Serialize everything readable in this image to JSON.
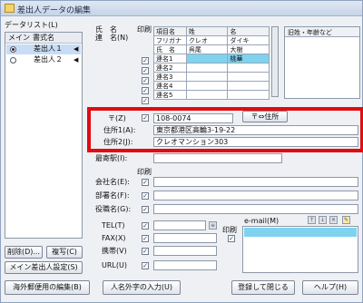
{
  "window": {
    "title": "差出人データの編集"
  },
  "data_list": {
    "label": "データリスト(L)",
    "columns": [
      "メイン",
      "書式名"
    ],
    "rows": [
      {
        "main_selected": true,
        "name": "差出人１"
      },
      {
        "main_selected": false,
        "name": "差出人２"
      }
    ]
  },
  "names": {
    "label_line1": "氏　名",
    "label_line2": "連　名(N)",
    "print_label": "印刷",
    "headers": [
      "項目名",
      "姓",
      "名"
    ],
    "rows": [
      {
        "item": "フリガナ",
        "sei": "クレオ",
        "mei": "ダイキ",
        "print": null
      },
      {
        "item": "氏　名",
        "sei": "呉尾",
        "mei": "大樹",
        "print": null
      },
      {
        "item": "連名1",
        "sei": "",
        "mei": "桃華",
        "print": true
      },
      {
        "item": "連名2",
        "sei": "",
        "mei": "",
        "print": true
      },
      {
        "item": "連名3",
        "sei": "",
        "mei": "",
        "print": true
      },
      {
        "item": "連名4",
        "sei": "",
        "mei": "",
        "print": true
      },
      {
        "item": "連名5",
        "sei": "",
        "mei": "",
        "print": true
      }
    ],
    "old_name_label": "旧姓・年齢など"
  },
  "address": {
    "zip_label": "〒(Z)",
    "zip_value": "108-0074",
    "zip_button": "〒⇔住所",
    "addr1_label": "住所1(A):",
    "addr1_value": "東京都港区高輪3-19-22",
    "addr2_label": "住所2(J):",
    "addr2_value": "クレオマンション303",
    "station_label": "最寄駅(I):"
  },
  "org": {
    "print_label": "印刷",
    "company_label": "会社名(E):",
    "dept_label": "部署名(F):",
    "title_label": "役職名(G):"
  },
  "contact": {
    "tel_label": "TEL(T)",
    "fax_label": "FAX(X)",
    "mobile_label": "携帯(V)",
    "url_label": "URL(U)",
    "print_label": "印刷",
    "email_label": "e-mail(M)"
  },
  "buttons": {
    "delete": "削除(D)...",
    "copy": "複写(C)",
    "main_sender": "メイン差出人設定(S)",
    "overseas": "海外郵便用の編集(B)",
    "gaiji": "人名外字の入力(U)",
    "register": "登録して閉じる",
    "help": "ヘルプ(H)"
  },
  "colors": {
    "highlight": "#e10b10",
    "selection": "#7fd3ee",
    "selected_row": "#c9dcf5"
  }
}
